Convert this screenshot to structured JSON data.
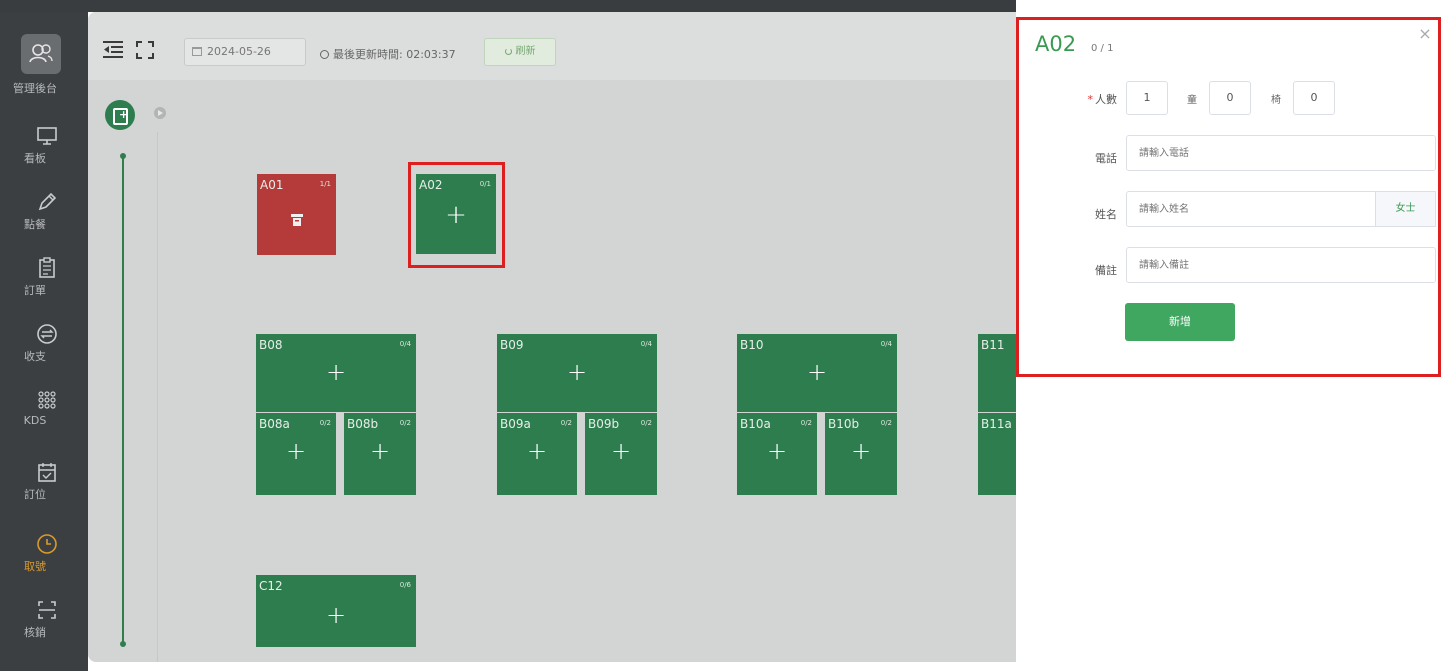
{
  "sidebar": {
    "items": [
      {
        "label": "管理後台",
        "icon": "users-icon"
      },
      {
        "label": "看板",
        "icon": "monitor-icon"
      },
      {
        "label": "點餐",
        "icon": "pencil-icon"
      },
      {
        "label": "訂單",
        "icon": "clipboard-icon"
      },
      {
        "label": "收支",
        "icon": "money-icon"
      },
      {
        "label": "KDS",
        "icon": "grid-dots-icon"
      },
      {
        "label": "訂位",
        "icon": "calendar-check-icon"
      },
      {
        "label": "取號",
        "icon": "clock-icon"
      },
      {
        "label": "核銷",
        "icon": "scan-icon"
      }
    ],
    "active_index": 7
  },
  "toolbar": {
    "date": "2024-05-26",
    "update_label": "最後更新時間: 02:03:37",
    "refresh_label": "刷新"
  },
  "tables": [
    {
      "name": "A01",
      "cap": "1/1",
      "status": "occupied"
    },
    {
      "name": "A02",
      "cap": "0/1",
      "status": "empty"
    },
    {
      "name": "B08",
      "cap": "0/4"
    },
    {
      "name": "B08a",
      "cap": "0/2"
    },
    {
      "name": "B08b",
      "cap": "0/2"
    },
    {
      "name": "B09",
      "cap": "0/4"
    },
    {
      "name": "B09a",
      "cap": "0/2"
    },
    {
      "name": "B09b",
      "cap": "0/2"
    },
    {
      "name": "B10",
      "cap": "0/4"
    },
    {
      "name": "B10a",
      "cap": "0/2"
    },
    {
      "name": "B10b",
      "cap": "0/2"
    },
    {
      "name": "B11",
      "cap": ""
    },
    {
      "name": "B11a",
      "cap": ""
    },
    {
      "name": "C12",
      "cap": "0/6"
    }
  ],
  "plus_glyph": "+",
  "panel": {
    "title": "A02",
    "subtitle": "0 / 1",
    "close": "×",
    "people_label": "人數",
    "required_mark": "*",
    "adults": "1",
    "child_label": "童",
    "children": "0",
    "chair_label": "椅",
    "chairs": "0",
    "phone_label": "電話",
    "phone_placeholder": "請輸入電話",
    "name_label": "姓名",
    "name_placeholder": "請輸入姓名",
    "gender_suffix": "女士",
    "note_label": "備註",
    "note_placeholder": "請輸入備註",
    "submit_label": "新增"
  },
  "colors": {
    "table_green": "#2e7d4f",
    "table_red": "#b53b3b",
    "accent_green": "#3fa760",
    "highlight_red": "#dd1f1f",
    "active_orange": "#d99a2b"
  }
}
